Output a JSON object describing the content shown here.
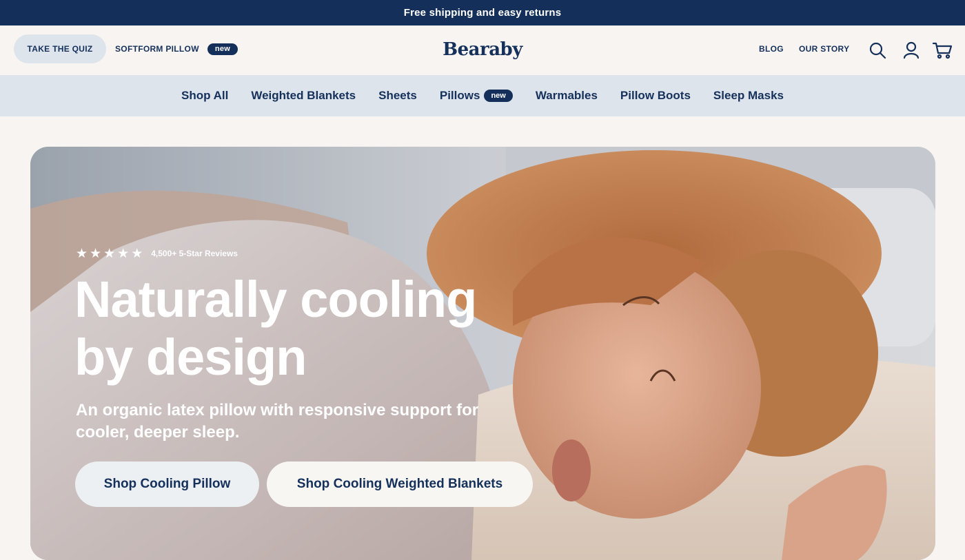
{
  "announcement": "Free shipping and easy returns",
  "header": {
    "quiz_label": "TAKE THE QUIZ",
    "softform_label": "SOFTFORM PILLOW",
    "softform_badge": "new",
    "logo": "Bearaby",
    "blog_label": "BLOG",
    "story_label": "OUR STORY",
    "icons": [
      "search-icon",
      "account-icon",
      "cart-icon"
    ]
  },
  "subnav": {
    "items": [
      "Shop All",
      "Weighted Blankets",
      "Sheets",
      "Pillows",
      "Warmables",
      "Pillow Boots",
      "Sleep Masks"
    ],
    "pillows_badge": "new"
  },
  "hero": {
    "rating_stars": 5,
    "reviews_text": "4,500+ 5-Star Reviews",
    "headline_line1": "Naturally cooling",
    "headline_line2": "by design",
    "subheadline": "An organic latex pillow with responsive support for cooler, deeper sleep.",
    "cta_primary": "Shop Cooling Pillow",
    "cta_secondary": "Shop Cooling Weighted Blankets"
  },
  "colors": {
    "navy": "#14305a",
    "cream": "#f8f4f1",
    "subnav_bg": "#dde4ec"
  }
}
